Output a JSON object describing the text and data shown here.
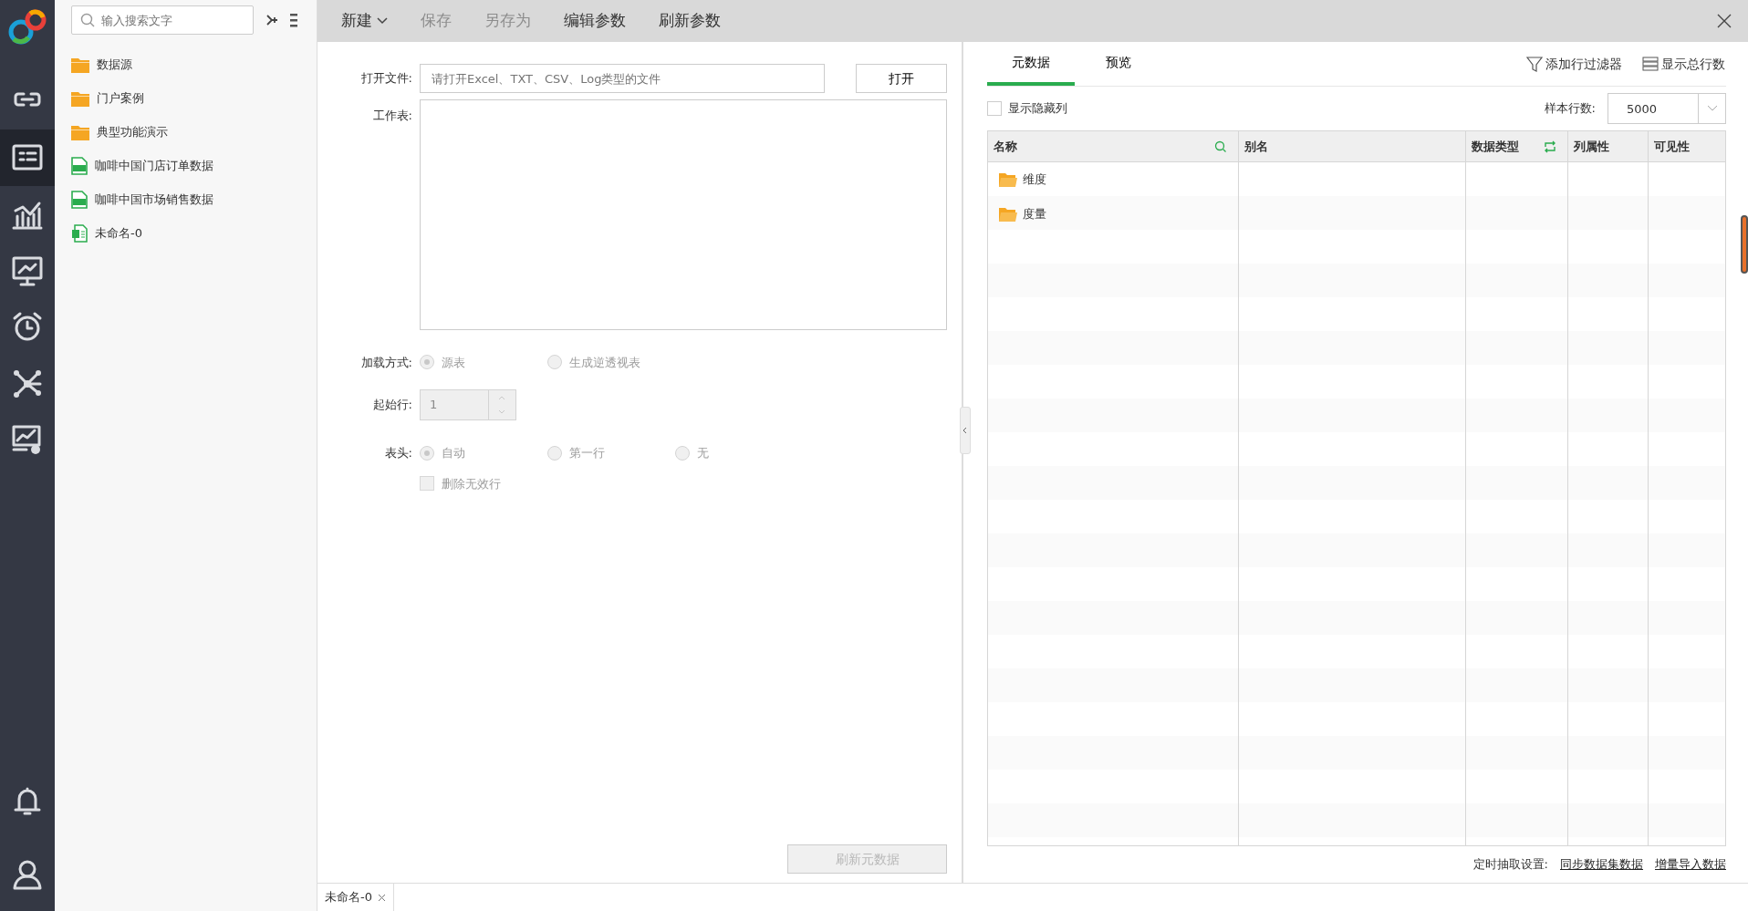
{
  "rail": [
    {
      "kind": "link",
      "selected": false
    },
    {
      "kind": "dataset",
      "selected": true
    },
    {
      "kind": "chart",
      "selected": false
    },
    {
      "kind": "presentation",
      "selected": false
    },
    {
      "kind": "alarm",
      "selected": false
    },
    {
      "kind": "network",
      "selected": false
    },
    {
      "kind": "monitor",
      "selected": false
    }
  ],
  "rail_bottom": [
    {
      "kind": "bell"
    },
    {
      "kind": "user"
    }
  ],
  "tree": {
    "search": {
      "placeholder": "输入搜索文字"
    },
    "items": [
      {
        "kind": "folder",
        "label": "数据源"
      },
      {
        "kind": "folder",
        "label": "门户案例"
      },
      {
        "kind": "folder",
        "label": "典型功能演示"
      },
      {
        "kind": "sql",
        "label": "咖啡中国门店订单数据"
      },
      {
        "kind": "sql",
        "label": "咖啡中国市场销售数据"
      },
      {
        "kind": "excel",
        "label": "未命名-0"
      }
    ]
  },
  "toolbar": [
    {
      "label": "新建",
      "dropdown": true,
      "disabled": false
    },
    {
      "label": "保存",
      "dropdown": false,
      "disabled": true
    },
    {
      "label": "另存为",
      "dropdown": false,
      "disabled": true
    },
    {
      "label": "编辑参数",
      "dropdown": false,
      "disabled": false
    },
    {
      "label": "刷新参数",
      "dropdown": false,
      "disabled": false
    }
  ],
  "form": {
    "open_file": {
      "label": "打开文件:",
      "placeholder": "请打开Excel、TXT、CSV、Log类型的文件",
      "button": "打开"
    },
    "worksheet": {
      "label": "工作表:"
    },
    "load_mode": {
      "label": "加载方式:",
      "options": [
        {
          "label": "源表",
          "selected": true,
          "disabled": true
        },
        {
          "label": "生成逆透视表",
          "selected": false,
          "disabled": true
        }
      ]
    },
    "start_row": {
      "label": "起始行:",
      "value": "1",
      "disabled": true
    },
    "header": {
      "label": "表头:",
      "options": [
        {
          "label": "自动",
          "selected": true,
          "disabled": true
        },
        {
          "label": "第一行",
          "selected": false,
          "disabled": true
        },
        {
          "label": "无",
          "selected": false,
          "disabled": true
        }
      ]
    },
    "remove_invalid": {
      "label": "删除无效行",
      "checked": false,
      "disabled": true
    },
    "refresh_button": {
      "label": "刷新元数据",
      "disabled": true
    }
  },
  "right": {
    "tabs": [
      {
        "label": "元数据",
        "selected": true
      },
      {
        "label": "预览",
        "selected": false
      }
    ],
    "actions": [
      {
        "kind": "filter",
        "label": "添加行过滤器"
      },
      {
        "kind": "rows",
        "label": "显示总行数"
      }
    ],
    "show_hidden": {
      "label": "显示隐藏列",
      "checked": false
    },
    "sample_rows": {
      "label": "样本行数:",
      "value": "5000"
    },
    "table": {
      "columns": [
        {
          "label": "名称",
          "searchable": true,
          "toggle": false
        },
        {
          "label": "别名",
          "searchable": false,
          "toggle": false
        },
        {
          "label": "数据类型",
          "searchable": false,
          "toggle": true
        },
        {
          "label": "列属性",
          "searchable": false,
          "toggle": false
        },
        {
          "label": "可见性",
          "searchable": false,
          "toggle": false
        }
      ],
      "rows": [
        {
          "name": "维度"
        },
        {
          "name": "度量"
        }
      ]
    },
    "footer": {
      "label": "定时抽取设置:",
      "links": [
        "同步数据集数据",
        "增量导入数据"
      ]
    }
  },
  "bottom_tabs": [
    {
      "label": "未命名-0",
      "selected": true
    }
  ]
}
